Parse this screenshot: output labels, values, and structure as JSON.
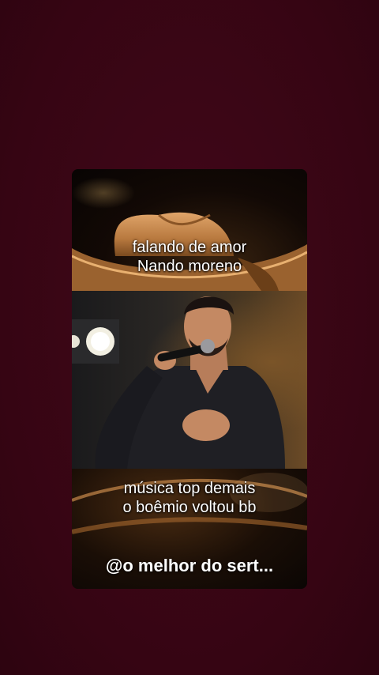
{
  "overlay": {
    "top_caption": [
      "falando de amor",
      "Nando moreno"
    ],
    "middle_caption": [
      "música top demais",
      "o boêmio voltou bb"
    ],
    "handle": "@o melhor do sert..."
  },
  "colors": {
    "background": "#3a0614",
    "caption_text": "#ffffff",
    "hat_gold": "#c8894a"
  }
}
